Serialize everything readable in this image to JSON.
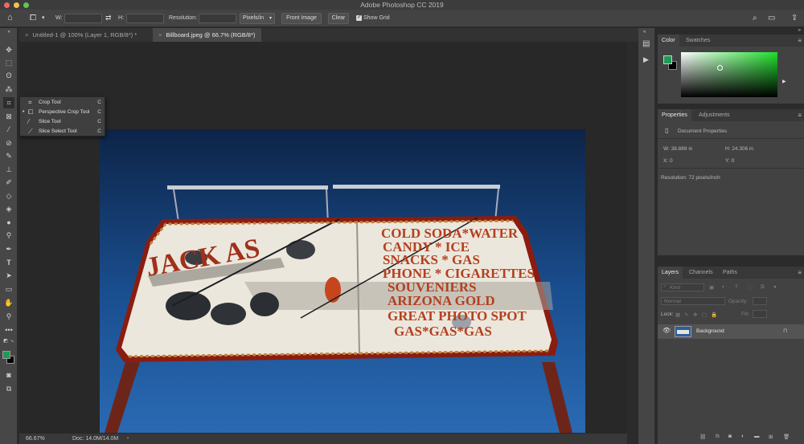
{
  "window": {
    "title": "Adobe Photoshop CC 2019"
  },
  "options_bar": {
    "w_label": "W:",
    "h_label": "H:",
    "resolution_label": "Resolution:",
    "units_value": "Pixels/in",
    "front_image_label": "Front Image",
    "clear_label": "Clear",
    "show_grid_label": "Show Grid"
  },
  "tabs": [
    {
      "label": "Untitled-1 @ 100% (Layer 1, RGB/8*) *"
    },
    {
      "label": "Billboard.jpeg @ 66.7% (RGB/8*)"
    }
  ],
  "flyout": {
    "items": [
      {
        "label": "Crop Tool",
        "key": "C"
      },
      {
        "label": "Perspective Crop Tool",
        "key": "C"
      },
      {
        "label": "Slice Tool",
        "key": "C"
      },
      {
        "label": "Slice Select Tool",
        "key": "C"
      }
    ]
  },
  "sign": {
    "left_text": "JACK AS",
    "lines": [
      "COLD SODA*WATER",
      "CANDY * ICE",
      "SNACKS * GAS",
      "PHONE * CIGARETTES",
      "SOUVENIERS",
      "ARIZONA GOLD",
      "GREAT PHOTO SPOT",
      "GAS*GAS*GAS"
    ]
  },
  "status": {
    "zoom": "66.67%",
    "doc": "Doc: 14.0M/14.0M"
  },
  "color_panel": {
    "tabs": [
      "Color",
      "Swatches"
    ],
    "foreground": "#1e9a55",
    "background": "#000000"
  },
  "properties_panel": {
    "tabs": [
      "Properties",
      "Adjustments"
    ],
    "doc_props": "Document Properties",
    "w": "W: 38.889 in",
    "h": "H: 24.306 in",
    "x": "X: 0",
    "y": "Y: 0",
    "resolution": "Resolution: 72 pixels/inch"
  },
  "layers_panel": {
    "tabs": [
      "Layers",
      "Channels",
      "Paths"
    ],
    "kind": "Kind",
    "blend": "Normal",
    "opacity_label": "Opacity:",
    "lock_label": "Lock:",
    "fill_label": "Fill:",
    "layer_name": "Background"
  }
}
